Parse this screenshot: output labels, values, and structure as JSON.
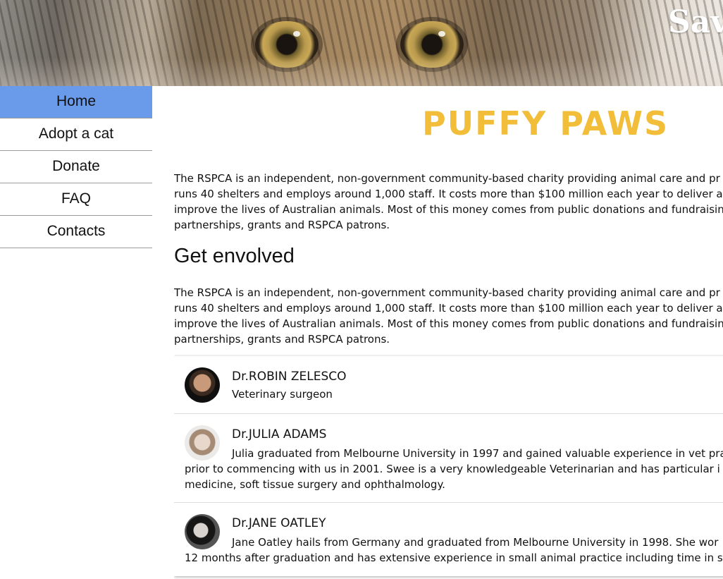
{
  "header": {
    "banner_title": "Sav"
  },
  "sidebar": {
    "items": [
      {
        "label": "Home",
        "active": true
      },
      {
        "label": "Adopt a cat",
        "active": false
      },
      {
        "label": "Donate",
        "active": false
      },
      {
        "label": "FAQ",
        "active": false
      },
      {
        "label": "Contacts",
        "active": false
      }
    ]
  },
  "main": {
    "logo": "PUFFY PAWS",
    "intro_paragraph": "The RSPCA is an independent, non-government community-based charity providing animal care and pr\nruns 40 shelters and employs around 1,000 staff. It costs more than $100 million each year to deliver a\nimprove the lives of Australian animals. Most of this money comes from public donations and fundraisin\npartnerships, grants and RSPCA patrons.",
    "section_title": "Get envolved",
    "section_paragraph": "The RSPCA is an independent, non-government community-based charity providing animal care and pr\nruns 40 shelters and employs around 1,000 staff. It costs more than $100 million each year to deliver a\nimprove the lives of Australian animals. Most of this money comes from public donations and fundraisin\npartnerships, grants and RSPCA patrons.",
    "staff": [
      {
        "name": "Dr.ROBIN ZELESCO",
        "role": "Veterinary surgeon"
      },
      {
        "name": "Dr.JULIA ADAMS",
        "bio": "Julia graduated from Melbourne University in 1997 and gained valuable experience in vet pra\nprior to commencing with us in 2001. Swee is a very knowledgeable Veterinarian and has particular i\nmedicine, soft tissue surgery and ophthalmology."
      },
      {
        "name": "Dr.JANE OATLEY",
        "bio": "Jane Oatley hails from Germany and graduated from Melbourne University in 1998. She wor\n12 months after graduation and has extensive experience in small animal practice including time in s"
      }
    ]
  },
  "colors": {
    "nav_active": "#6a9aea",
    "logo": "#f2be3a"
  }
}
